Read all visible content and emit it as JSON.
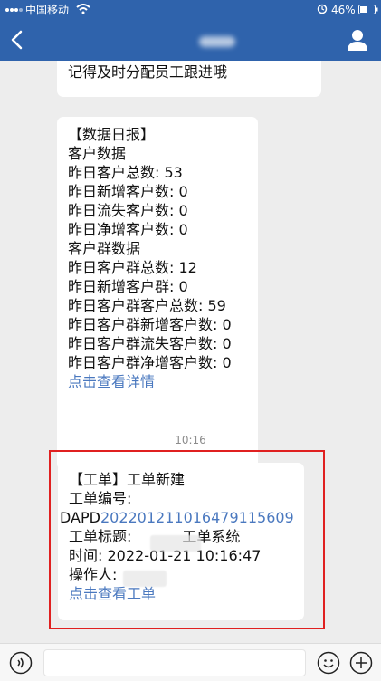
{
  "status_bar": {
    "carrier": "中国移动",
    "battery": "46%"
  },
  "messages": {
    "first": "记得及时分配员工跟进哦",
    "daily_report": {
      "title": "【数据日报】",
      "customer_section": "客户数据",
      "total_customers": "昨日客户总数: 53",
      "new_customers": "昨日新增客户数: 0",
      "lost_customers": "昨日流失客户数: 0",
      "net_new_customers": "昨日净增客户数: 0",
      "group_section": "客户群数据",
      "total_groups": "昨日客户群总数: 12",
      "new_groups": "昨日新增客户群: 0",
      "group_total_customers": "昨日客户群客户总数: 59",
      "group_new_customers": "昨日客户群新增客户数: 0",
      "group_lost_customers": "昨日客户群流失客户数: 0",
      "group_net_new_customers": "昨日客户群净增客户数: 0",
      "link": "点击查看详情"
    },
    "time_separator": "10:16",
    "work_order": {
      "title": "【工单】工单新建",
      "number_label": "工单编号:",
      "number_prefix": "DAPD",
      "number_value": "20220121101647911560",
      "number_suffix": "9",
      "subject_label": "工单标题:",
      "subject_suffix": "工单系统",
      "time": "时间: 2022-01-21 10:16:47",
      "operator_label": "操作人:",
      "link": "点击查看工单"
    }
  },
  "input": {
    "placeholder": ""
  },
  "colors": {
    "header": "#2f63ac",
    "link": "#4a78bf",
    "highlight": "#e02020",
    "background": "#ededed"
  }
}
